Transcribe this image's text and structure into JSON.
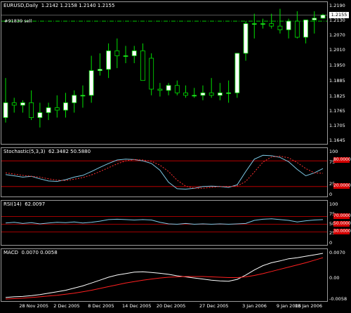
{
  "main": {
    "symbol": "EURUSD,Daily",
    "ohlc": "1.2142 1.2158 1.2140 1.2155",
    "order_line_label": "#91839 sell",
    "current_price": "1.2155",
    "price_scale": [
      "1.2190",
      "1.2130",
      "1.2070",
      "1.2010",
      "1.1950",
      "1.1885",
      "1.1825",
      "1.1765",
      "1.1705",
      "1.1645"
    ]
  },
  "stochastic": {
    "label": "Stochastic(5,3,3)",
    "values": "62.3482 50.5880",
    "scale": [
      "100",
      "75",
      "25",
      "0"
    ],
    "levels": [
      "80.0000",
      "20.0000"
    ]
  },
  "rsi": {
    "label": "RSI(14)",
    "value": "62.0097",
    "scale": [
      "100",
      "75",
      "50",
      "25",
      "0"
    ],
    "levels": [
      "70.0000",
      "50.0000",
      "30.0000"
    ]
  },
  "macd": {
    "label": "MACD",
    "values": "0.0070 0.0058",
    "scale": [
      "0.0070",
      "0.00",
      "-0.0058"
    ]
  },
  "time_axis": [
    "28 Nov 2005",
    "2 Dec 2005",
    "8 Dec 2005",
    "14 Dec 2005",
    "20 Dec 2005",
    "27 Dec 2005",
    "3 Jan 2006",
    "9 Jan 2006",
    "13 Jan 2006"
  ],
  "colors": {
    "bull_body": "#ffffff",
    "bear_body": "#000000",
    "wick": "#00e000",
    "main_line": "#7ec9e6",
    "signal_line": "#ff3030",
    "level_line": "#d40000",
    "macd_line": "#ffffff",
    "macd_signal": "#ff2020"
  },
  "chart_data": [
    {
      "type": "candlestick",
      "title": "EURUSD,Daily",
      "ylim": [
        1.1645,
        1.219
      ],
      "x": [
        "2005-11-24",
        "2005-11-25",
        "2005-11-28",
        "2005-11-29",
        "2005-11-30",
        "2005-12-01",
        "2005-12-02",
        "2005-12-05",
        "2005-12-06",
        "2005-12-07",
        "2005-12-08",
        "2005-12-09",
        "2005-12-12",
        "2005-12-13",
        "2005-12-14",
        "2005-12-15",
        "2005-12-16",
        "2005-12-19",
        "2005-12-20",
        "2005-12-21",
        "2005-12-22",
        "2005-12-23",
        "2005-12-26",
        "2005-12-27",
        "2005-12-28",
        "2005-12-29",
        "2005-12-30",
        "2006-01-02",
        "2006-01-03",
        "2006-01-04",
        "2006-01-05",
        "2006-01-06",
        "2006-01-09",
        "2006-01-10",
        "2006-01-11",
        "2006-01-12",
        "2006-01-13",
        "2006-01-16"
      ],
      "open": [
        1.174,
        1.18,
        1.179,
        1.18,
        1.174,
        1.176,
        1.178,
        1.177,
        1.18,
        1.183,
        1.183,
        1.193,
        1.1935,
        1.201,
        1.199,
        1.199,
        1.201,
        1.198,
        1.1855,
        1.185,
        1.187,
        1.184,
        1.183,
        1.183,
        1.184,
        1.183,
        1.184,
        1.184,
        1.2,
        1.212,
        1.212,
        1.212,
        1.211,
        1.2095,
        1.213,
        1.2065,
        1.2135,
        1.2142
      ],
      "high": [
        1.19,
        1.182,
        1.181,
        1.185,
        1.18,
        1.18,
        1.183,
        1.184,
        1.185,
        1.187,
        1.199,
        1.2,
        1.204,
        1.206,
        1.203,
        1.203,
        1.204,
        1.2,
        1.188,
        1.188,
        1.189,
        1.187,
        1.186,
        1.187,
        1.19,
        1.188,
        1.189,
        1.2,
        1.213,
        1.216,
        1.214,
        1.216,
        1.218,
        1.214,
        1.217,
        1.213,
        1.217,
        1.216
      ],
      "low": [
        1.172,
        1.176,
        1.176,
        1.173,
        1.17,
        1.173,
        1.174,
        1.174,
        1.176,
        1.178,
        1.18,
        1.191,
        1.19,
        1.194,
        1.196,
        1.196,
        1.192,
        1.183,
        1.1825,
        1.183,
        1.183,
        1.182,
        1.182,
        1.181,
        1.182,
        1.181,
        1.18,
        1.182,
        1.197,
        1.206,
        1.21,
        1.21,
        1.208,
        1.206,
        1.206,
        1.204,
        1.208,
        1.214
      ],
      "close": [
        1.18,
        1.179,
        1.18,
        1.174,
        1.176,
        1.178,
        1.177,
        1.18,
        1.183,
        1.183,
        1.193,
        1.1935,
        1.201,
        1.199,
        1.199,
        1.201,
        1.189,
        1.1855,
        1.185,
        1.187,
        1.184,
        1.183,
        1.183,
        1.184,
        1.183,
        1.184,
        1.184,
        1.2,
        1.212,
        1.212,
        1.212,
        1.211,
        1.2095,
        1.213,
        1.2065,
        1.2135,
        1.2142,
        1.2155
      ],
      "order_line": 1.213
    },
    {
      "type": "line",
      "title": "Stochastic(5,3,3)",
      "ylim": [
        0,
        100
      ],
      "levels": [
        80,
        20
      ],
      "series": [
        {
          "name": "main",
          "values": [
            48,
            45,
            42,
            44,
            38,
            33,
            32,
            36,
            42,
            46,
            55,
            65,
            74,
            82,
            84,
            83,
            80,
            74,
            58,
            30,
            15,
            14,
            16,
            20,
            21,
            20,
            18,
            24,
            55,
            84,
            93,
            92,
            88,
            78,
            60,
            45,
            52,
            62
          ]
        },
        {
          "name": "signal",
          "values": [
            52,
            49,
            46,
            44,
            42,
            38,
            35,
            34,
            37,
            41,
            47,
            55,
            64,
            73,
            80,
            83,
            82,
            79,
            70,
            55,
            35,
            21,
            16,
            16,
            18,
            20,
            20,
            21,
            32,
            54,
            77,
            89,
            91,
            87,
            76,
            62,
            52,
            51
          ]
        }
      ]
    },
    {
      "type": "line",
      "title": "RSI(14)",
      "ylim": [
        0,
        100
      ],
      "levels": [
        70,
        50,
        30
      ],
      "series": [
        {
          "name": "RSI",
          "values": [
            53,
            55,
            52,
            54,
            51,
            53,
            55,
            54,
            56,
            53,
            55,
            58,
            62,
            63,
            62,
            61,
            62,
            61,
            55,
            51,
            50,
            52,
            50,
            51,
            50,
            51,
            50,
            51,
            52,
            60,
            63,
            64,
            62,
            60,
            56,
            59,
            61,
            62
          ]
        }
      ]
    },
    {
      "type": "line",
      "title": "MACD",
      "ylim": [
        -0.0058,
        0.007
      ],
      "series": [
        {
          "name": "MACD",
          "values": [
            -0.0052,
            -0.005,
            -0.0049,
            -0.0047,
            -0.0044,
            -0.004,
            -0.0036,
            -0.0032,
            -0.0026,
            -0.002,
            -0.0012,
            -0.0004,
            0.0004,
            0.001,
            0.0014,
            0.0018,
            0.0019,
            0.0017,
            0.0015,
            0.0012,
            0.0008,
            0.0005,
            0.0002,
            -0.0001,
            -0.0004,
            -0.0006,
            -0.0007,
            -0.0002,
            0.001,
            0.0024,
            0.0036,
            0.0044,
            0.0049,
            0.0055,
            0.0058,
            0.0062,
            0.0066,
            0.007
          ]
        },
        {
          "name": "Signal",
          "values": [
            -0.0056,
            -0.0055,
            -0.0054,
            -0.0052,
            -0.005,
            -0.0048,
            -0.0046,
            -0.0043,
            -0.004,
            -0.0036,
            -0.0032,
            -0.0027,
            -0.0022,
            -0.0017,
            -0.0012,
            -0.0008,
            -0.0004,
            -0.0001,
            0.0002,
            0.0004,
            0.0005,
            0.0006,
            0.0006,
            0.0006,
            0.0005,
            0.0004,
            0.0003,
            0.0003,
            0.0005,
            0.0009,
            0.0014,
            0.002,
            0.0026,
            0.0032,
            0.0038,
            0.0044,
            0.0051,
            0.0058
          ]
        }
      ]
    }
  ]
}
